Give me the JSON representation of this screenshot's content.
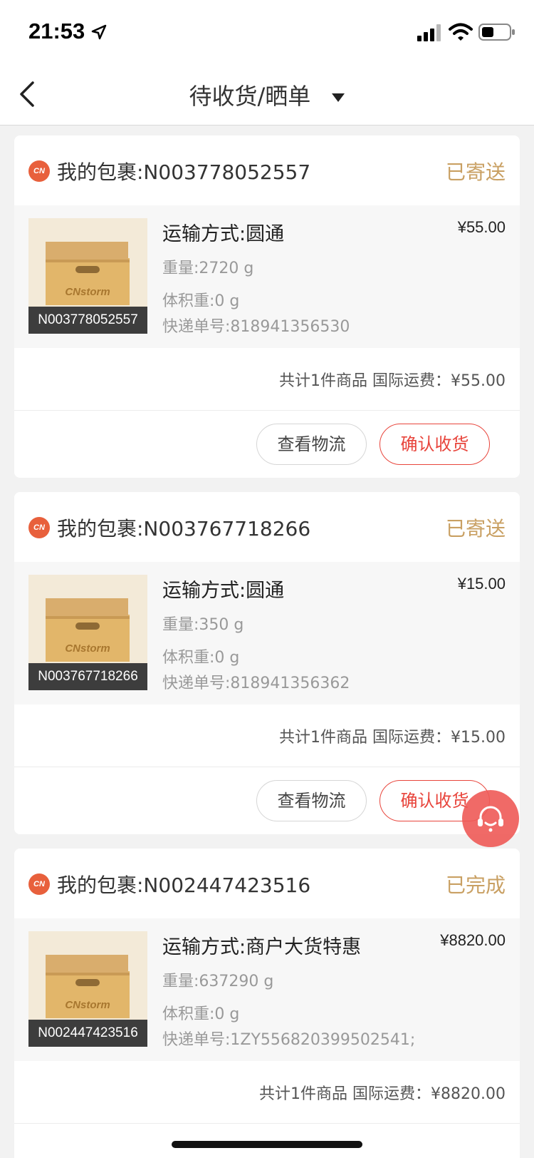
{
  "status_bar": {
    "time": "21:53"
  },
  "nav": {
    "title": "待收货/晒单"
  },
  "packages": [
    {
      "pkg_label": "我的包裹:N003778052557",
      "status": "已寄送",
      "thumb_caption": "N003778052557",
      "ship_method": "运输方式:圆通",
      "price": "¥55.00",
      "weight": "重量:2720 g",
      "volume_weight": "体积重:0 g",
      "tracking": "快递单号:818941356530",
      "summary": "共计1件商品 国际运费：¥55.00",
      "btn_logistics": "查看物流",
      "btn_confirm": "确认收货"
    },
    {
      "pkg_label": "我的包裹:N003767718266",
      "status": "已寄送",
      "thumb_caption": "N003767718266",
      "ship_method": "运输方式:圆通",
      "price": "¥15.00",
      "weight": "重量:350 g",
      "volume_weight": "体积重:0 g",
      "tracking": "快递单号:818941356362",
      "summary": "共计1件商品 国际运费：¥15.00",
      "btn_logistics": "查看物流",
      "btn_confirm": "确认收货"
    },
    {
      "pkg_label": "我的包裹:N002447423516",
      "status": "已完成",
      "thumb_caption": "N002447423516",
      "ship_method": "运输方式:商户大货特惠",
      "price": "¥8820.00",
      "weight": "重量:637290 g",
      "volume_weight": "体积重:0 g",
      "tracking": "快递单号:1ZY556820399502541;",
      "summary": "共计1件商品 国际运费：¥8820.00"
    }
  ],
  "brand": {
    "logo_text": "CN",
    "box_brand": "CNstorm"
  },
  "colors": {
    "status_gold": "#c9a063",
    "confirm_red": "#e8453c",
    "logo_orange": "#e8603c",
    "float_button": "#ee5a56"
  },
  "icons": [
    "location-arrow-icon",
    "signal-icon",
    "wifi-icon",
    "battery-icon",
    "back-chevron-icon",
    "dropdown-caret-icon",
    "customer-service-icon"
  ]
}
